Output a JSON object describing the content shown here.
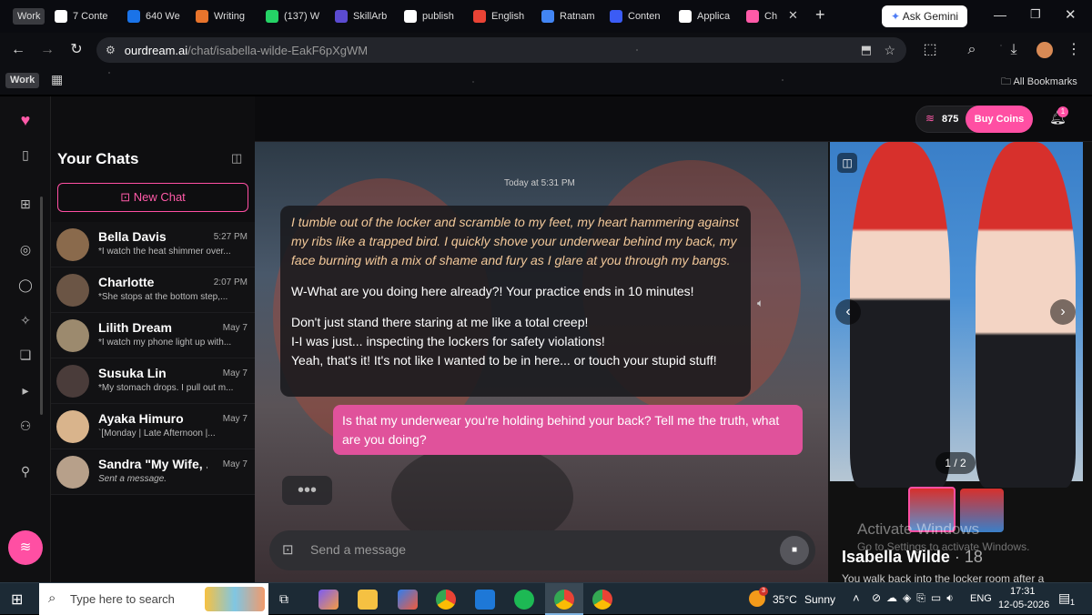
{
  "browser": {
    "profile_chip": "Work",
    "tabs": [
      {
        "label": "7 Conte",
        "color": "#ffffff"
      },
      {
        "label": "640 We",
        "color": "#1a73e8"
      },
      {
        "label": "Writing",
        "color": "#e8742c"
      },
      {
        "label": "(137) W",
        "color": "#25d366"
      },
      {
        "label": "SkillArb",
        "color": "#5b4bd1"
      },
      {
        "label": "publish",
        "color": "#ffffff"
      },
      {
        "label": "English",
        "color": "#ea4335"
      },
      {
        "label": "Ratnam",
        "color": "#4285f4"
      },
      {
        "label": "Conten",
        "color": "#3b5cf5"
      },
      {
        "label": "Applica",
        "color": "#ffffff"
      },
      {
        "label": "Ch",
        "color": "#ff5aa8"
      }
    ],
    "new_tab": "+",
    "ask_gemini": "Ask Gemini",
    "url_domain": "ourdream.ai",
    "url_path": "/chat/isabella-wilde-EakF6pXgWM",
    "bookmarks_label": "All Bookmarks",
    "work_chip": "Work"
  },
  "header": {
    "coins": "875",
    "buy_coins": "Buy Coins",
    "notification_count": "1"
  },
  "sidebar": {
    "title": "Your Chats",
    "new_chat": "New Chat",
    "chats": [
      {
        "name": "Bella Davis",
        "time": "5:27 PM",
        "preview": "*I watch the heat shimmer over...",
        "avatar_color": "#8a6a4c"
      },
      {
        "name": "Charlotte",
        "time": "2:07 PM",
        "preview": "*She stops at the bottom step,...",
        "avatar_color": "#6b5545"
      },
      {
        "name": "Lilith Dream",
        "time": "May 7",
        "preview": "*I watch my phone light up with...",
        "avatar_color": "#9c8a6e"
      },
      {
        "name": "Susuka Lin",
        "time": "May 7",
        "preview": "*My stomach drops. I pull out m...",
        "avatar_color": "#4a3c3a"
      },
      {
        "name": "Ayaka Himuro",
        "time": "May 7",
        "preview": "`[Monday | Late Afternoon |...",
        "avatar_color": "#d9b48c"
      },
      {
        "name": "Sandra \"My Wife, ...",
        "time": "May 7",
        "preview": "Sent a message.",
        "avatar_color": "#b7a08a"
      }
    ]
  },
  "chat": {
    "timestamp": "Today at 5:31 PM",
    "ai_narration": "I tumble out of the locker and scramble to my feet, my heart hammering against my ribs like a trapped bird. I quickly shove your underwear behind my back, my face burning with a mix of shame and fury as I glare at you through my bangs.",
    "ai_line1": "W-What are you doing here already?! Your practice ends in 10 minutes!",
    "ai_line2": "Don't just stand there staring at me like a total creep!",
    "ai_line3": "I-I was just... inspecting the lockers for safety violations!",
    "ai_line4": "Yeah, that's it! It's not like I wanted to be in here... or touch your stupid stuff!",
    "user_message": "Is that my underwear you're holding behind your back? Tell me the truth, what are you doing?",
    "typing": "•••",
    "input_placeholder": "Send a message"
  },
  "gallery": {
    "counter": "1 / 2",
    "character_name": "Isabella Wilde",
    "character_age": "· 18",
    "description": "You walk back into the locker room after a",
    "watermark_title": "Activate Windows",
    "watermark_sub": "Go to Settings to activate Windows."
  },
  "taskbar": {
    "search_placeholder": "Type here to search",
    "weather_temp": "35°C",
    "weather_desc": "Sunny",
    "weather_badge": "3",
    "language": "ENG",
    "time": "17:31",
    "date": "12-05-2026",
    "notif_count": "1"
  },
  "colors": {
    "accent_pink": "#e0529b",
    "buy_coins": "#ff4fa3",
    "tab_active": "#ff5aa8"
  }
}
